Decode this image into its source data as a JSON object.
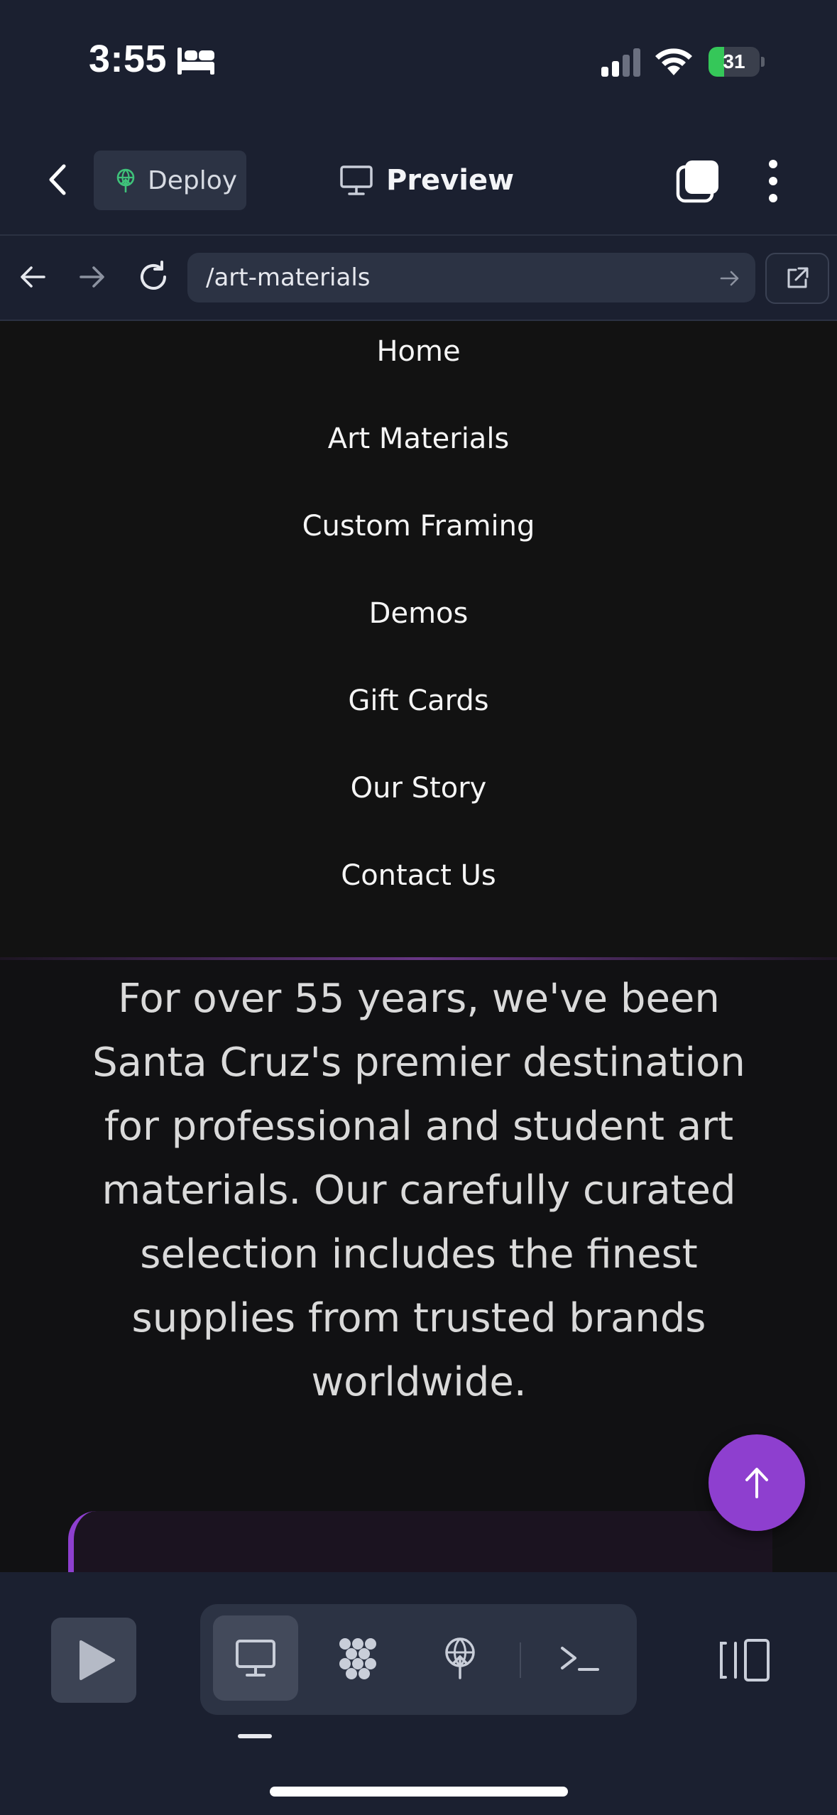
{
  "status_bar": {
    "time": "3:55",
    "battery_percent": "31",
    "battery_level": 0.31,
    "icons": [
      "sleep-bed-icon",
      "cellular-signal-icon",
      "wifi-icon",
      "battery-charging-icon"
    ]
  },
  "toolbar": {
    "deploy_label": "Deploy",
    "preview_label": "Preview",
    "icons": [
      "back-chevron-icon",
      "deploy-globe-icon",
      "monitor-icon",
      "tabs-icon",
      "more-vertical-icon"
    ]
  },
  "browser": {
    "url": "/art-materials",
    "icons": [
      "arrow-left-icon",
      "arrow-right-icon",
      "reload-icon",
      "url-go-arrow-icon",
      "open-external-icon"
    ]
  },
  "site": {
    "nav_items": [
      {
        "label": "Home"
      },
      {
        "label": "Art Materials"
      },
      {
        "label": "Custom Framing"
      },
      {
        "label": "Demos"
      },
      {
        "label": "Gift Cards"
      },
      {
        "label": "Our Story"
      },
      {
        "label": "Contact Us"
      }
    ],
    "intro": "For over 55 years, we've been Santa Cruz's premier destination for professional and student art materials. Our carefully curated selection includes the finest supplies from trusted brands worldwide."
  },
  "bottom_bar": {
    "icons": [
      "play-icon",
      "desktop-view-icon",
      "cluster-view-icon",
      "deploy-globe-icon",
      "terminal-icon",
      "side-panel-icon"
    ]
  },
  "colors": {
    "chrome_background": "#1b2030",
    "control_background": "#2c3344",
    "page_background": "#121212",
    "accent_purple": "#8e3fcf",
    "battery_green": "#35c759",
    "deploy_green": "#3fc27a"
  }
}
